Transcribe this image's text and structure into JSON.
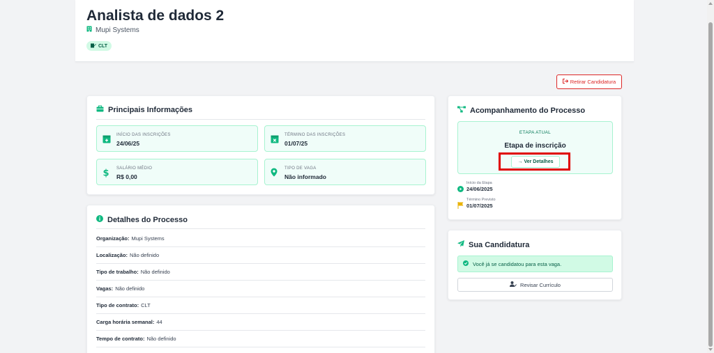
{
  "job": {
    "title": "Analista de dados 2",
    "company": "Mupi Systems",
    "contract_badge": "CLT"
  },
  "actions": {
    "withdraw_label": "Retirar Candidatura"
  },
  "main_info": {
    "title": "Principais Informações",
    "items": [
      {
        "label": "INÍCIO DAS INSCRIÇÕES",
        "value": "24/06/25",
        "icon": "calendar-plus-icon"
      },
      {
        "label": "TÉRMINO DAS INSCRIÇÕES",
        "value": "01/07/25",
        "icon": "calendar-x-icon"
      },
      {
        "label": "SALÁRIO MÉDIO",
        "value": "R$ 0,00",
        "icon": "dollar-icon"
      },
      {
        "label": "TIPO DE VAGA",
        "value": "Não informado",
        "icon": "map-pin-icon"
      }
    ]
  },
  "process_details": {
    "title": "Detalhes do Processo",
    "rows": [
      {
        "label": "Organização:",
        "value": "Mupi Systems"
      },
      {
        "label": "Localização:",
        "value": "Não definido"
      },
      {
        "label": "Tipo de trabalho:",
        "value": "Não definido"
      },
      {
        "label": "Vagas:",
        "value": "Não definido"
      },
      {
        "label": "Tipo de contrato:",
        "value": "CLT"
      },
      {
        "label": "Carga horária semanal:",
        "value": "44"
      },
      {
        "label": "Tempo de contrato:",
        "value": "Não definido"
      }
    ]
  },
  "tracking": {
    "title": "Acompanhamento do Processo",
    "stage_label": "ETAPA ATUAL",
    "stage_name": "Etapa de inscrição",
    "details_button": "→ Ver Detalhes",
    "start_label": "Início da Etapa",
    "start_value": "24/06/2025",
    "end_label": "Término Previsto",
    "end_value": "01/07/2025"
  },
  "application": {
    "title": "Sua Candidatura",
    "success_message": "Você já se candidatou para esta vaga.",
    "review_button": "Revisar Currículo"
  },
  "colors": {
    "accent": "#10b981",
    "danger": "#dc2626",
    "highlight": "#e00000"
  }
}
